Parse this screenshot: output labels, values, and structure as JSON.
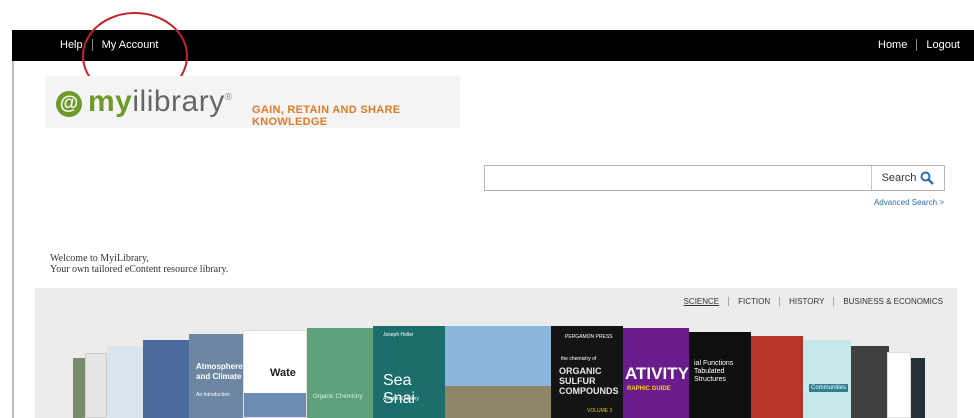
{
  "topbar": {
    "help": "Help",
    "my_account": "My Account",
    "home": "Home",
    "logout": "Logout"
  },
  "logo": {
    "mark": "@",
    "brand_prefix": "my",
    "brand_suffix": "ilibrary",
    "tagline": "GAIN, RETAIN AND SHARE KNOWLEDGE"
  },
  "search": {
    "value": "",
    "button": "Search",
    "advanced": "Advanced Search >"
  },
  "welcome": {
    "line1": "Welcome to MyiLibrary,",
    "line2": "Your own tailored eContent resource library."
  },
  "categories": [
    "SCIENCE",
    "FICTION",
    "HISTORY",
    "BUSINESS & ECONOMICS"
  ],
  "books": {
    "atmosphere_title": "Atmosphere and Climate",
    "atmosphere_sub": "An Introduction",
    "water": "Wate",
    "organic": "Organic Chemistry",
    "sea_snail_title": "Sea Snai",
    "sea_snail_author": "Joseph Heller",
    "sea_snail_sub": "A natural history",
    "pergamon": "PERGAMON PRESS",
    "organic_sulfur": "ORGANIC SULFUR COMPOUNDS",
    "organic_sulfur_lead": "the chemistry of",
    "organic_sulfur_vol": "VOLUME 3",
    "activity": "ATIVITY",
    "graphic_guide": "RAPHIC GUIDE",
    "functions": "ial Functions Tabulated Structures",
    "communities": "Communities"
  },
  "colors": {
    "topbar": "#000000",
    "highlight_circle": "#c4222b",
    "brand_green": "#6e9a2a",
    "tagline_orange": "#e07b25",
    "link_blue": "#2a6fb5"
  }
}
